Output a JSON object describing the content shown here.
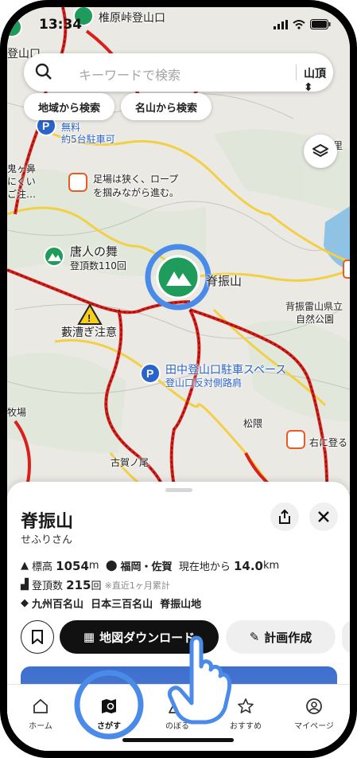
{
  "status": {
    "time": "13:34",
    "location": "椎原峠登山口"
  },
  "search": {
    "placeholder": "キーワードで検索",
    "filter": "山頂"
  },
  "chips": [
    "地域から検索",
    "名山から検索"
  ],
  "map_labels": {
    "top_left": "登山口",
    "parking_free": "無料",
    "parking_count": "約5台駐車可",
    "onigahana_lines": [
      "鬼ヶ鼻",
      "にくい",
      "ご注…"
    ],
    "warning_note_lines": [
      "足場は狭く、ロープ",
      "を掴みながら進む。"
    ],
    "karato": "唐人の舞",
    "karato_count": "登頂数110回",
    "yabu": "藪漕ぎ注意",
    "seburi_map": "脊振山",
    "park_name": "背振雷山県立",
    "park_name2": "自然公園",
    "tanaka_parking": "田中登山口駐車スペース",
    "tanaka_sub": "登山口反対側路肩",
    "matsukuma": "松隈",
    "migi": "右に登る",
    "furuga": "古賀ノ尾",
    "bokujo": "牧場",
    "ri": "里"
  },
  "detail": {
    "name": "脊振山",
    "reading": "せふりさん",
    "altitude_label": "標高",
    "altitude_value": "1054",
    "altitude_unit": "m",
    "prefecture": "福岡・佐賀",
    "distance_label": "現在地から",
    "distance_value": "14.0",
    "distance_unit": "km",
    "climbs_label": "登頂数",
    "climbs_value": "215",
    "climbs_unit": "回",
    "climbs_note": "※直近1ヶ月累計",
    "tags": [
      "九州百名山",
      "日本三百名山",
      "脊振山地"
    ],
    "download_label": "地図ダウンロード",
    "plan_label": "計画作成"
  },
  "tabs": [
    "ホーム",
    "さがす",
    "のぼる",
    "おすすめ",
    "マイページ"
  ],
  "colors": {
    "accent_blue": "#4a8ae8",
    "mountain_green": "#1f9b5b",
    "road_red": "#d9201b",
    "road_yellow": "#f2d046",
    "parking_blue": "#2a63c9"
  }
}
